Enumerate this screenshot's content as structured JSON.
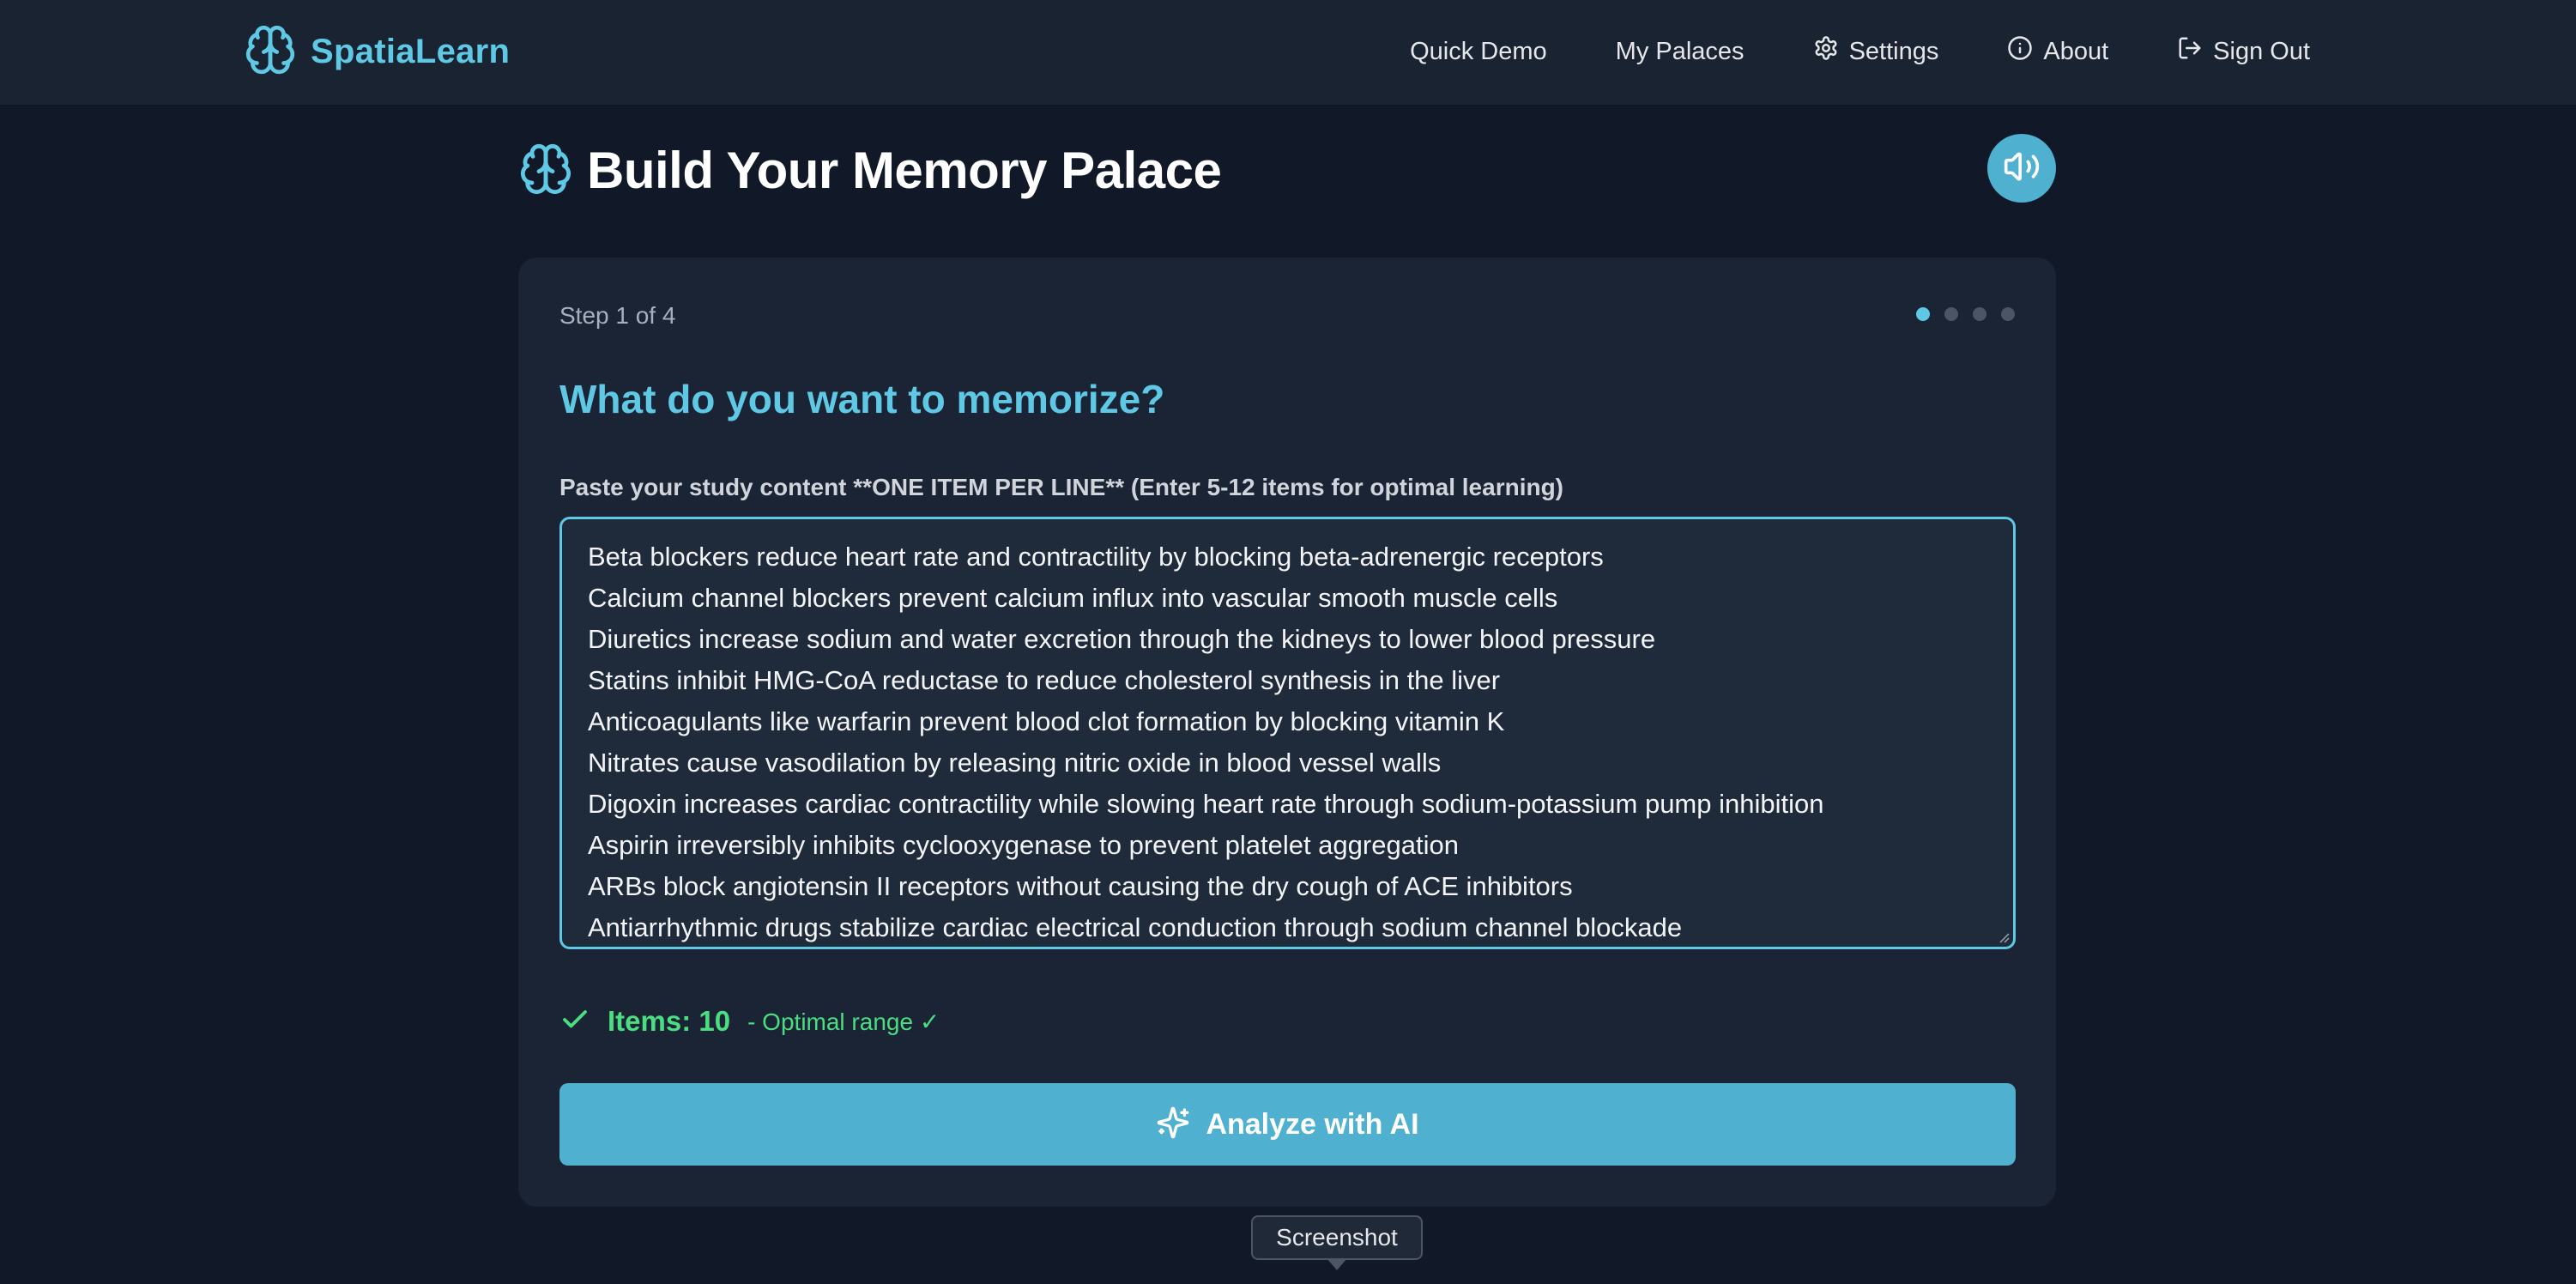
{
  "nav": {
    "brand": "SpatiaLearn",
    "links": [
      {
        "label": "Quick Demo",
        "icon": "none"
      },
      {
        "label": "My Palaces",
        "icon": "none"
      },
      {
        "label": "Settings",
        "icon": "gear-icon"
      },
      {
        "label": "About",
        "icon": "info-icon"
      },
      {
        "label": "Sign Out",
        "icon": "sign-out-icon"
      }
    ]
  },
  "header": {
    "title": "Build Your Memory Palace"
  },
  "wizard": {
    "step_text": "Step 1 of 4",
    "total_steps": 4,
    "current_step": 1,
    "question": "What do you want to memorize?",
    "field_label": "Paste your study content **ONE ITEM PER LINE** (Enter 5-12 items for optimal learning)",
    "items": [
      "Beta blockers reduce heart rate and contractility by blocking beta-adrenergic receptors",
      "Calcium channel blockers prevent calcium influx into vascular smooth muscle cells",
      "Diuretics increase sodium and water excretion through the kidneys to lower blood pressure",
      "Statins inhibit HMG-CoA reductase to reduce cholesterol synthesis in the liver",
      "Anticoagulants like warfarin prevent blood clot formation by blocking vitamin K",
      "Nitrates cause vasodilation by releasing nitric oxide in blood vessel walls",
      "Digoxin increases cardiac contractility while slowing heart rate through sodium-potassium pump inhibition",
      "Aspirin irreversibly inhibits cyclooxygenase to prevent platelet aggregation",
      "ARBs block angiotensin II receptors without causing the dry cough of ACE inhibitors",
      "Antiarrhythmic drugs stabilize cardiac electrical conduction through sodium channel blockade"
    ],
    "count_label": "Items: 10",
    "count_note": "- Optimal range ✓",
    "analyze_label": "Analyze with AI"
  },
  "tooltip": "Screenshot",
  "colors": {
    "accent": "#5ec8e5",
    "button": "#4fb0d0",
    "success": "#4ade80",
    "background": "#111827",
    "card": "#1b2434"
  }
}
